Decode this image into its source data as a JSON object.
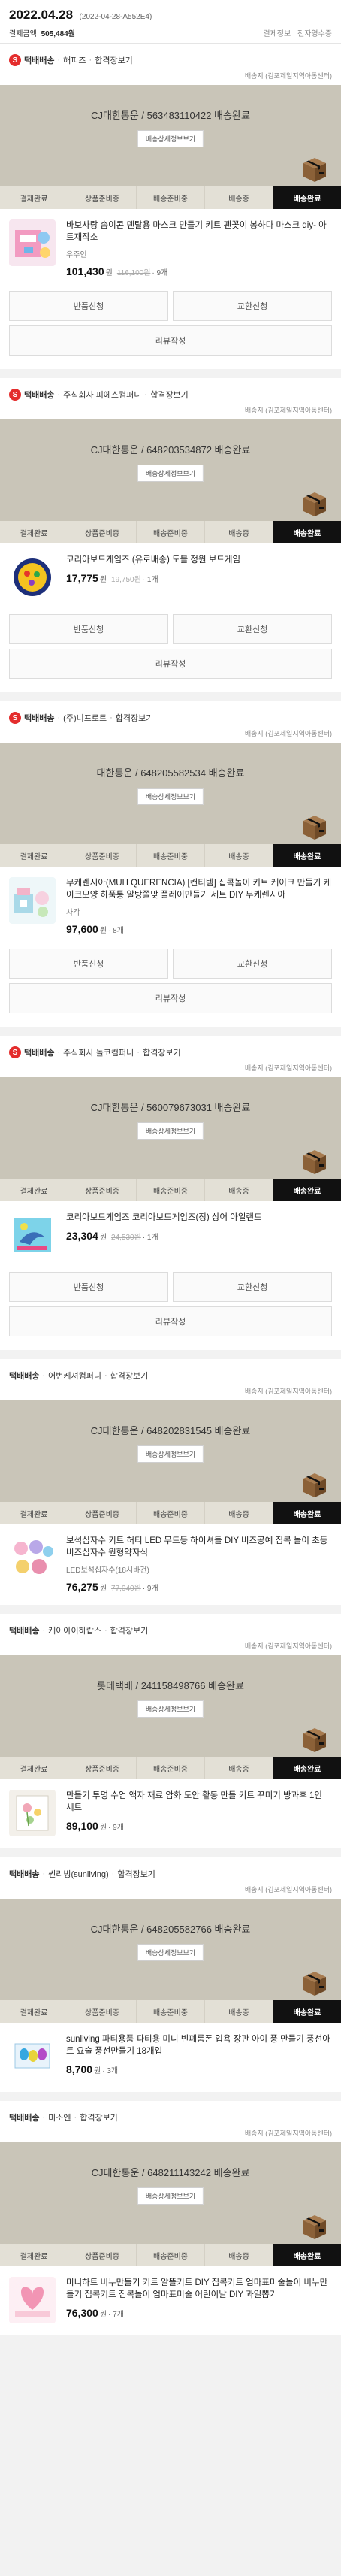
{
  "order": {
    "date": "2022.04.28",
    "id": "(2022-04-28-A552E4)",
    "payment_label": "결제금액",
    "payment_amount": "505,484원",
    "detail_link": "결제정보",
    "delete_link": "전자영수증"
  },
  "labels": {
    "track_button": "배송상세정보보기",
    "steps": [
      "결제완료",
      "상품준비중",
      "배송준비중",
      "배송중",
      "배송완료"
    ],
    "cancel": "반품신청",
    "exchange": "교환신청",
    "review": "리뷰작성",
    "won": "원",
    "addr": "배송지 (김포제일지역아동센터)"
  },
  "shipments": [
    {
      "badge": "S",
      "ship_type": "택배배송",
      "seller": "해피즈",
      "cart": "합격장보기",
      "carrier": "CJ대한통운 / 563483110422 배송완료",
      "product": {
        "name": "바보사랑 솜이콘 덴탈용 마스크 만들기 키트 펜꽂이 봉하다 마스크 diy- 아트재작소",
        "option": "우주인",
        "price": "101,430",
        "orig": "116,100원",
        "qty": "· 9개",
        "thumb": "kit-pink"
      },
      "actions": [
        "반품신청",
        "교환신청",
        "리뷰작성"
      ]
    },
    {
      "badge": "S",
      "ship_type": "택배배송",
      "seller": "주식회사 피에스컴퍼니",
      "cart": "합격장보기",
      "carrier": "CJ대한통운 / 648203534872 배송완료",
      "product": {
        "name": "코리아보드게임즈 (유로배송) 도블 정원 보드게임",
        "option": "",
        "price": "17,775",
        "orig": "19,750원",
        "qty": "· 1개",
        "thumb": "dobble"
      },
      "actions": [
        "반품신청",
        "교환신청",
        "리뷰작성"
      ]
    },
    {
      "badge": "S",
      "ship_type": "택배배송",
      "seller": "(주)니프로트",
      "cart": "합격장보기",
      "carrier": "대한통운 / 648205582534 배송완료",
      "product": {
        "name": "무케렌시아(MUH QUERENCIA) [컨티템] 집콕놀이 키트 케이크 만들기 케이크모양 하품통 알탕쫄맞 플레이만들기 세트 DIY 무케렌시아",
        "option": "사각",
        "price": "97,600",
        "orig": "",
        "qty": "· 8개",
        "thumb": "cake"
      },
      "actions": [
        "반품신청",
        "교환신청",
        "리뷰작성"
      ]
    },
    {
      "badge": "S",
      "ship_type": "택배배송",
      "seller": "주식회사 돌코컴퍼니",
      "cart": "합격장보기",
      "carrier": "CJ대한통운 / 560079673031 배송완료",
      "product": {
        "name": "코리아보드게임즈 코리아보드게임즈(정) 상어 아일랜드",
        "option": "",
        "price": "23,304",
        "orig": "24,530원",
        "qty": "· 1개",
        "thumb": "shark"
      },
      "actions": [
        "반품신청",
        "교환신청",
        "리뷰작성"
      ]
    },
    {
      "badge": "",
      "ship_type": "택배배송",
      "seller": "어번케셔컴퍼니",
      "cart": "합격장보기",
      "carrier": "CJ대한통운 / 648202831545 배송완료",
      "product": {
        "name": "보석십자수 키트 허티 LED 무드등 하이셔들 DIY 비즈공예 집콕 놀이 초등 비즈십자수 원형약자식",
        "option": "LED보석십자수(18시바건)",
        "price": "76,275",
        "orig": "77,040원",
        "qty": "· 9개",
        "thumb": "gem"
      },
      "actions": []
    },
    {
      "badge": "",
      "ship_type": "택배배송",
      "seller": "케이아이하랍스",
      "cart": "합격장보기",
      "carrier": "롯데택배 / 241158498766 배송완료",
      "product": {
        "name": "만들기 투명 수업 액자 재료 압화 도안 활동 만들 키트 꾸미기 방과후 1인 세트",
        "option": "",
        "price": "89,100",
        "orig": "",
        "qty": "· 9개",
        "thumb": "flower"
      },
      "actions": []
    },
    {
      "badge": "",
      "ship_type": "택배배송",
      "seller": "썬리빙(sunliving)",
      "cart": "합격장보기",
      "carrier": "CJ대한통운 / 648205582766 배송완료",
      "product": {
        "name": "sunliving 파티용품 파티용 미니 빈폐룸폰 입욕 장판 아이 풍 만들기 풍선아트 요술 풍선만들기 18개입",
        "option": "",
        "price": "8,700",
        "orig": "",
        "qty": "· 3개",
        "thumb": "balloon"
      },
      "actions": []
    },
    {
      "badge": "",
      "ship_type": "택배배송",
      "seller": "미소엔",
      "cart": "합격장보기",
      "carrier": "CJ대한통운 / 648211143242 배송완료",
      "product": {
        "name": "미니하트 비누만들기 키트 알뜰키트 DIY 집콕키트 엄마표미술놀이 비누만들기 집콕키트 집콕놀이 엄마표미술 어린이날 DIY 과일뽑기",
        "option": "",
        "price": "76,300",
        "orig": "",
        "qty": "· 7개",
        "thumb": "soap"
      },
      "actions": []
    }
  ]
}
